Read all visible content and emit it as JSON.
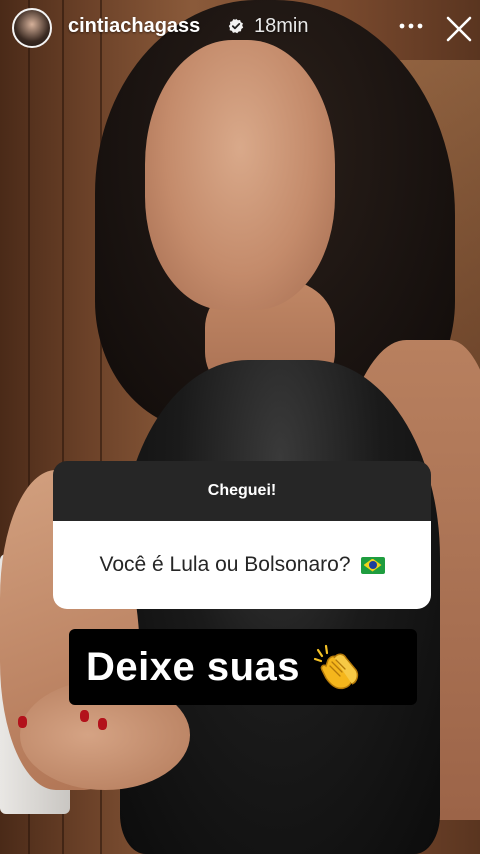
{
  "header": {
    "username": "cintiachagass",
    "time_ago": "18min",
    "icons": [
      "avatar",
      "verified-badge-icon",
      "more-options-icon",
      "close-icon"
    ]
  },
  "question_sticker": {
    "title": "Cheguei!",
    "question": "Você é Lula ou Bolsonaro?",
    "emoji": "brazil-flag-icon"
  },
  "caption": {
    "text": "Deixe suas",
    "emoji": "clapping-hands-icon"
  },
  "colors": {
    "sticker_header": "#262626",
    "sticker_body": "#ffffff",
    "caption_bg": "#000000",
    "text_light": "#ffffff"
  }
}
